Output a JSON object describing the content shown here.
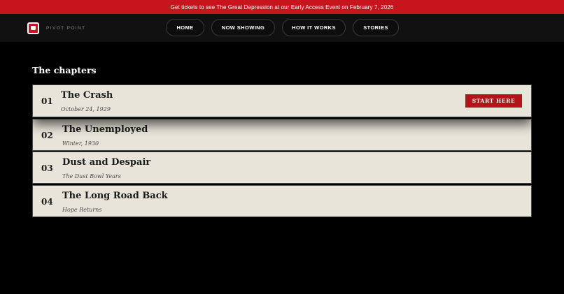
{
  "announcement": "Get tickets to see The Great Depression at our Early Access Event on February 7, 2026",
  "brand": {
    "name": "PIVOT POINT",
    "logo_icon": "film-logo-icon"
  },
  "nav": {
    "items": [
      "HOME",
      "NOW SHOWING",
      "HOW IT WORKS",
      "STORIES"
    ]
  },
  "section": {
    "title": "The chapters"
  },
  "chapters": [
    {
      "num": "01",
      "title": "The Crash",
      "subtitle": "October 24, 1929",
      "cta": "START HERE"
    },
    {
      "num": "02",
      "title": "The Unemployed",
      "subtitle": "Winter, 1930"
    },
    {
      "num": "03",
      "title": "Dust and Despair",
      "subtitle": "The Dust Bowl Years"
    },
    {
      "num": "04",
      "title": "The Long Road Back",
      "subtitle": "Hope Returns"
    }
  ],
  "colors": {
    "accent": "#c8141c",
    "card": "#e8e4d9",
    "background": "#000000"
  }
}
